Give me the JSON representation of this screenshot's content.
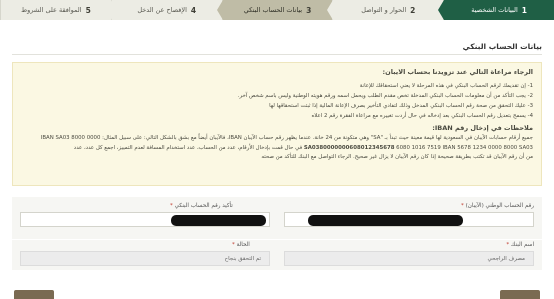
{
  "steps": [
    {
      "number": "1",
      "label": "البيانات الشخصية",
      "state": "done"
    },
    {
      "number": "2",
      "label": "الحوار و التواصل",
      "state": "pending"
    },
    {
      "number": "3",
      "label": "بيانات الحساب البنكي",
      "state": "active"
    },
    {
      "number": "4",
      "label": "الإفصاح عن الدخل",
      "state": "pending"
    },
    {
      "number": "5",
      "label": "الموافقة على الشروط",
      "state": "pending"
    }
  ],
  "page_title": "بيانات الحساب البنكي",
  "notice": {
    "heading": "الرجاء مراعاة التالي عند تزويدنا بحساب الايبان:",
    "items": [
      "1- إن تقديمك لرقم الحساب البنكي في هذه المرحلة لا يعني استحقاقك للإعانة",
      "2- يجب التأكد من أن معلومات الحساب البنكي المدخلة تخص مقدم الطلب ويحمل اسمه ورقم هويته الوطنية وليس باسم شخص آخر.",
      "3- عليك التحقق من صحة رقم الحساب البنكي المدخل وذلك لتفادي التأخير بصرف الإعانة المالية إذا ثبتت استحقاقها لها",
      "4- يسمح بتعديل رقم الحساب البنكي بعد إدخاله في حال أردت تغييره مع مراعاة الفقرة رقم 2 اعلاه"
    ],
    "iban_title": "ملاحظات في إدخال رقم IBAN:",
    "iban_lines": [
      "جميع أرقام حسابات الآيبان في السعودية لها قيمة معينة حيث تبدأ بـ \"SA\" وهي متكونة من 24 خانة. عندما يظهر رقم حساب الآيبان IBAN، فالآيبان أيضاً مع بشق بالشكل التالي: على سبيل المثال: IBAN SA03 8000 0000",
      "6080 1016 7519 IBAN 5678 1234 0000 8000 SA03 في حال قمت بإدخال الأرقام، عدد من الحساب، عدد استخدام المسافة لعدم التمييز، اجمع كل عدد، عدد",
      "من أن رقم الآيبان قد تكتب بطريقة صحيحة إذا كان رقم الآيبان لا يزال غير صحيح. الرجاء التواصل مع البنك للتأكد من صحته"
    ],
    "iban_sample": "SA0380000000608012345678"
  },
  "form": {
    "iban_label": "رقم الحساب الوطني (الآيبان)",
    "iban_confirm_label": "تأكيد رقم الحساب البنكي",
    "bank_name_label": "اسم البنك",
    "bank_name_value": "مصرف الراجحي",
    "status_label": "الحالة",
    "status_value": "تم التحقق بنجاح",
    "required_mark": "*"
  }
}
